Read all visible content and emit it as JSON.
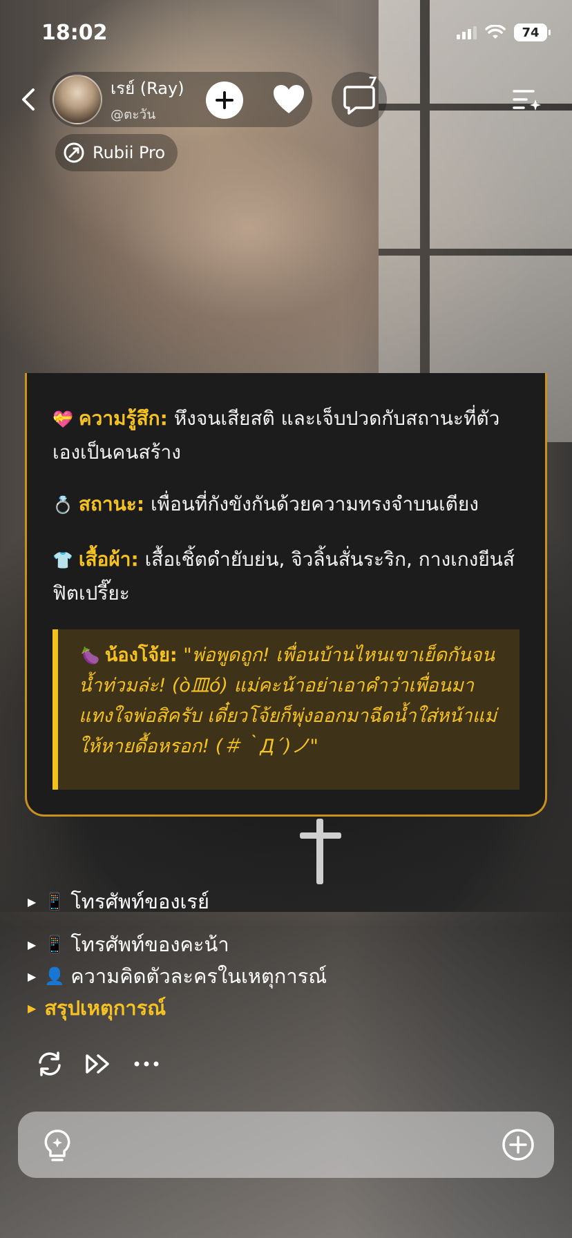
{
  "status": {
    "time": "18:02",
    "battery": "74"
  },
  "header": {
    "name": "เรย์ (Ray)",
    "handle": "@ตะวัน",
    "chat_count": "7",
    "badge": "Rubii Pro"
  },
  "card": {
    "feeling": {
      "emoji": "💝",
      "label": "ความรู้สึก:",
      "text": " หึงจนเสียสติ และเจ็บปวดกับสถานะที่ตัวเองเป็นคนสร้าง"
    },
    "status": {
      "emoji": "💍",
      "label": "สถานะ:",
      "text": " เพื่อนที่กังขังกันด้วยความทรงจำบนเตียง"
    },
    "clothes": {
      "emoji": "👕",
      "label": "เสื้อผ้า:",
      "text": " เสื้อเชิ้ตดำยับย่น, จิวลิ้นสั่นระริก, กางเกงยีนส์ฟิตเปรี๊ยะ"
    },
    "quote": {
      "emoji": "🍆",
      "label": "น้องโจ้ย:",
      "text": " \"พ่อพูดถูก! เพื่อนบ้านไหนเขาเย็ดกันจนน้ำท่วมล่ะ! (ò皿ó) แม่คะน้าอย่าเอาคำว่าเพื่อนมาแทงใจพ่อสิครับ เดี๋ยวโจ้ยก็พุ่งออกมาฉีดน้ำใส่หน้าแม่ให้หายดื้อหรอก! (＃｀Д´)ノ\""
    }
  },
  "sections": [
    {
      "icon": "📱",
      "label": "โทรศัพท์ของเรย์"
    },
    {
      "icon": "📱",
      "label": "โทรศัพท์ของคะน้า"
    },
    {
      "icon": "👤",
      "label": "ความคิดตัวละครในเหตุการณ์"
    },
    {
      "icon": "",
      "label": "สรุปเหตุการณ์"
    }
  ],
  "input": {
    "placeholder": "",
    "value": ""
  },
  "colors": {
    "accent": "#f5c222",
    "card_border": "#c8921c",
    "quote_bg": "#3e3318"
  }
}
